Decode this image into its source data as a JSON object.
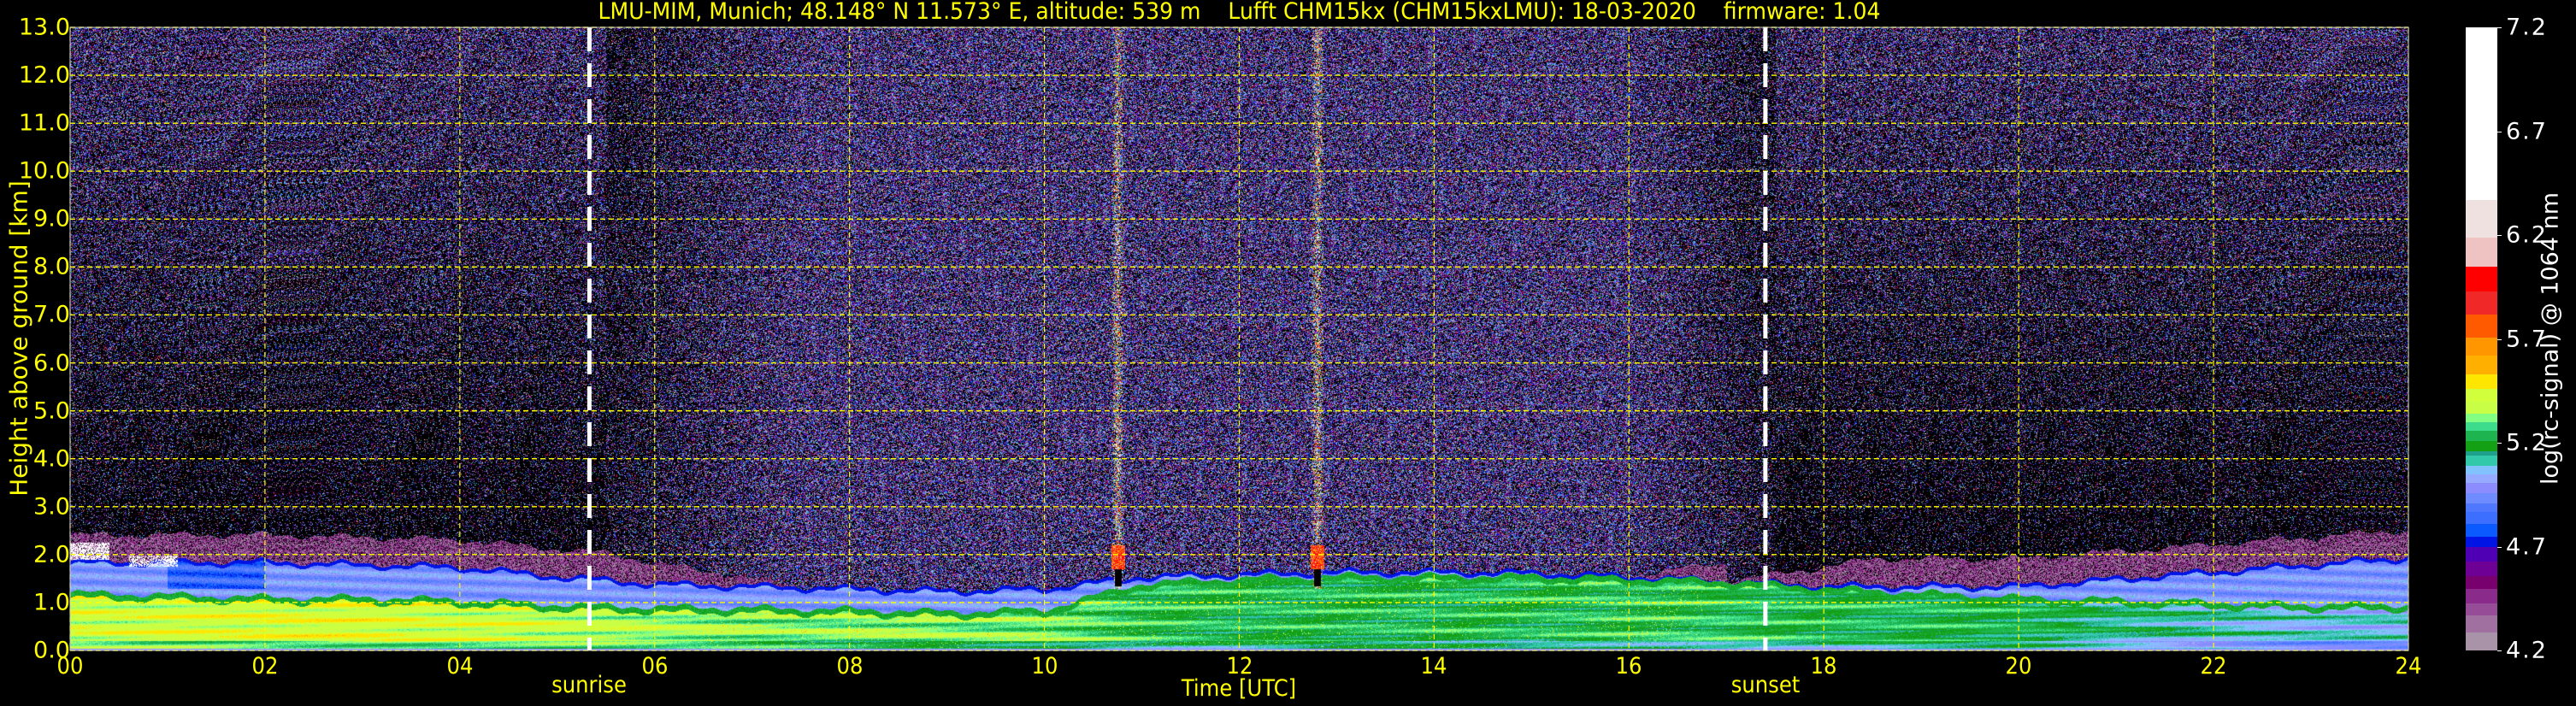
{
  "title": "LMU-MIM, Munich; 48.148° N 11.573° E, altitude: 539 m    Lufft CHM15kx (CHM15kxLMU): 18-03-2020    firmware: 1.04",
  "chart_data": {
    "type": "heatmap",
    "title": "LMU-MIM, Munich; 48.148° N 11.573° E, altitude: 539 m    Lufft CHM15kx (CHM15kxLMU): 18-03-2020    firmware: 1.04",
    "x_axis": {
      "label": "Time [UTC]",
      "range": [
        0,
        24
      ],
      "ticks": [
        0,
        2,
        4,
        6,
        8,
        10,
        12,
        14,
        16,
        18,
        20,
        22,
        24
      ],
      "tick_labels": [
        "00",
        "02",
        "04",
        "06",
        "08",
        "10",
        "12",
        "14",
        "16",
        "18",
        "20",
        "22",
        "24"
      ]
    },
    "y_axis": {
      "label": "Height above ground [km]",
      "range": [
        0,
        13
      ],
      "ticks": [
        0,
        1,
        2,
        3,
        4,
        5,
        6,
        7,
        8,
        9,
        10,
        11,
        12,
        13
      ],
      "tick_labels": [
        "0.0",
        "1.0",
        "2.0",
        "3.0",
        "4.0",
        "5.0",
        "6.0",
        "7.0",
        "8.0",
        "9.0",
        "10.0",
        "11.0",
        "12.0",
        "13.0"
      ]
    },
    "grid": true,
    "grid_color": "#ffff00",
    "annotations": [
      {
        "label": "sunrise",
        "x": 5.33
      },
      {
        "label": "sunset",
        "x": 17.4
      }
    ],
    "colorbar": {
      "label": "log(rc-signal) @ 1064 nm",
      "range": [
        4.2,
        7.2
      ],
      "ticks": [
        4.2,
        4.7,
        5.2,
        5.7,
        6.2,
        6.7,
        7.2
      ],
      "tick_labels": [
        "4.2",
        "4.7",
        "5.2",
        "5.7",
        "6.2",
        "6.7",
        "7.2"
      ],
      "bins": [
        [
          4.2,
          4.29,
          "#a893a8"
        ],
        [
          4.29,
          4.37,
          "#a070a0"
        ],
        [
          4.37,
          4.43,
          "#964c96"
        ],
        [
          4.43,
          4.5,
          "#8a2a8a"
        ],
        [
          4.5,
          4.56,
          "#78006e"
        ],
        [
          4.56,
          4.63,
          "#6e0096"
        ],
        [
          4.63,
          4.7,
          "#5000b4"
        ],
        [
          4.7,
          4.75,
          "#0014e6"
        ],
        [
          4.75,
          4.81,
          "#0a5aff"
        ],
        [
          4.81,
          4.87,
          "#3c6eff"
        ],
        [
          4.87,
          4.91,
          "#5078ff"
        ],
        [
          4.91,
          4.96,
          "#6e8cff"
        ],
        [
          4.96,
          5.01,
          "#8c8cff"
        ],
        [
          5.01,
          5.05,
          "#96aaff"
        ],
        [
          5.05,
          5.09,
          "#82c3ff"
        ],
        [
          5.09,
          5.14,
          "#32c8aa"
        ],
        [
          5.14,
          5.16,
          "#1ea08c"
        ],
        [
          5.16,
          5.21,
          "#14a014"
        ],
        [
          5.21,
          5.26,
          "#1eb450"
        ],
        [
          5.26,
          5.3,
          "#3cdc8c"
        ],
        [
          5.3,
          5.34,
          "#82ff82"
        ],
        [
          5.34,
          5.4,
          "#c8ff46"
        ],
        [
          5.4,
          5.46,
          "#d2ff3c"
        ],
        [
          5.46,
          5.53,
          "#ffe600"
        ],
        [
          5.53,
          5.62,
          "#ffaf00"
        ],
        [
          5.62,
          5.71,
          "#ff9600"
        ],
        [
          5.71,
          5.82,
          "#ff5a00"
        ],
        [
          5.82,
          5.93,
          "#f02828"
        ],
        [
          5.93,
          6.05,
          "#ff0000"
        ],
        [
          6.05,
          6.19,
          "#f0c3c3"
        ],
        [
          6.19,
          6.37,
          "#f0e1e1"
        ],
        [
          6.37,
          7.2,
          "#ffffff"
        ]
      ]
    },
    "layers": {
      "hours": [
        0,
        1,
        2,
        3,
        4,
        5,
        6,
        7,
        8,
        9,
        10,
        11,
        12,
        13,
        14,
        15,
        16,
        17,
        18,
        19,
        20,
        21,
        22,
        23,
        24
      ],
      "lower_layer_top_km": [
        1.1,
        1.05,
        1.0,
        1.0,
        0.95,
        0.85,
        0.8,
        0.78,
        0.75,
        0.7,
        0.75,
        1.3,
        1.4,
        1.45,
        1.45,
        1.45,
        1.4,
        1.35,
        1.2,
        1.1,
        1.0,
        0.95,
        0.9,
        0.85,
        0.85
      ],
      "upper_layer_top_km": [
        1.8,
        1.8,
        1.8,
        1.75,
        1.7,
        1.5,
        1.35,
        1.3,
        1.25,
        1.2,
        1.25,
        1.5,
        1.55,
        1.6,
        1.6,
        1.58,
        1.5,
        1.4,
        1.3,
        1.3,
        1.3,
        1.45,
        1.6,
        1.75,
        1.9
      ],
      "lower_layer_log_signal": [
        5.38,
        5.38,
        5.4,
        5.4,
        5.38,
        5.36,
        5.33,
        5.3,
        5.3,
        5.3,
        5.28,
        5.22,
        5.2,
        5.2,
        5.2,
        5.2,
        5.22,
        5.22,
        5.2,
        5.2,
        5.18,
        5.12,
        5.08,
        5.05,
        5.05
      ],
      "plumes_hours": [
        10.75,
        12.8
      ],
      "cloud_km": 2.0
    }
  }
}
